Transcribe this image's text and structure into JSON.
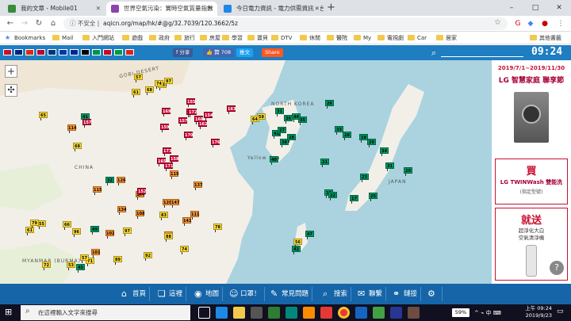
{
  "browser": {
    "tabs": [
      {
        "title": "我的文章 - Mobile01",
        "fav": "#3a8b3a",
        "active": false
      },
      {
        "title": "世界空氣污染：實時空氣質量指數",
        "fav": "#8e44ad",
        "active": true
      },
      {
        "title": "今日電力資訊 - 電力供需資訊 - 台灣電力",
        "fav": "#1e88e5",
        "active": false
      }
    ],
    "new_tab": "+",
    "window_controls": [
      "–",
      "□",
      "✕"
    ],
    "insecure_label": "不安全",
    "url": "aqicn.org/map/hk/#@g/32.7039/120.3662/5z",
    "bookmarks": [
      "Bookmarks",
      "Mail",
      "入門網站",
      "遊戲",
      "政府",
      "旅行",
      "房屋",
      "學習",
      "寶貝",
      "DTV",
      "休閒",
      "醫院",
      "My",
      "電視劇",
      "Car",
      "居家",
      "其他書籤"
    ]
  },
  "site": {
    "flag_colors": [
      "#c8102e",
      "#00247d",
      "#de2910",
      "#bc002d",
      "#003478",
      "#0039a6",
      "#002395",
      "#000000",
      "#009246",
      "#c60b1e",
      "#009c3b",
      "#da251d"
    ],
    "share_buttons": [
      {
        "label": "f 分享",
        "color": "#3b5998"
      },
      {
        "label": "👍 贊 708",
        "color": "#4267b2"
      },
      {
        "label": "推文",
        "color": "#1da1f2"
      },
      {
        "label": "Share",
        "color": "#ff5722"
      }
    ],
    "clock": "09:24"
  },
  "map": {
    "labels": [
      {
        "text": "GOBI DESERT",
        "id": "gobi"
      },
      {
        "text": "CHINA",
        "id": "china"
      },
      {
        "text": "NORTH KOREA",
        "id": "nk"
      },
      {
        "text": "Yellow Sea",
        "id": "ys"
      },
      {
        "text": "MYANMAR (BURMA)",
        "id": "mm"
      },
      {
        "text": "JAPAN",
        "id": "jp"
      }
    ],
    "sample_readings": [
      {
        "region": "gobi",
        "values": [
          53,
          57,
          74,
          61,
          97,
          68
        ]
      },
      {
        "region": "west-china",
        "values": [
          41,
          114,
          157,
          68,
          65,
          32
        ]
      },
      {
        "region": "north-china-plain",
        "values": [
          159,
          163,
          170,
          154,
          171,
          161,
          168,
          173,
          157,
          165,
          158,
          172,
          162,
          176,
          169,
          155
        ]
      },
      {
        "region": "central-china",
        "values": [
          115,
          128,
          137,
          144,
          108,
          152,
          126,
          119,
          134,
          141,
          111,
          147
        ]
      },
      {
        "region": "south-china",
        "values": [
          83,
          97,
          102,
          74,
          89,
          96,
          105,
          71,
          92,
          88,
          101,
          78
        ]
      },
      {
        "region": "southwest",
        "values": [
          61,
          57,
          45,
          72,
          55,
          79,
          53,
          49,
          66
        ]
      },
      {
        "region": "korea",
        "values": [
          38,
          42,
          27,
          35,
          31,
          44,
          36,
          28,
          40
        ]
      },
      {
        "region": "japan",
        "values": [
          23,
          17,
          31,
          28,
          19,
          26,
          33,
          21,
          18,
          25,
          29,
          22,
          34,
          20
        ]
      },
      {
        "region": "taiwan",
        "values": [
          42,
          47,
          56
        ]
      },
      {
        "region": "nk-seoul",
        "values": [
          58,
          64
        ]
      }
    ]
  },
  "ads": {
    "ad1_promo": "2019/7/1~2019/11/30",
    "ad1_brand": "LG 智慧家庭 聯享節",
    "ad2_big": "買",
    "ad2_sub": "LG TWINWash 雙能洗",
    "ad2_sub2": "(指定型號)",
    "ad3_big": "就送",
    "ad3_sub": "超淨化大白\n空氣清淨機",
    "help": "?"
  },
  "bottom_nav": [
    {
      "icon": "⌂",
      "label": "首頁"
    },
    {
      "icon": "❏",
      "label": "這裡"
    },
    {
      "icon": "◉",
      "label": "地圖"
    },
    {
      "icon": "☺",
      "label": "口罩！"
    },
    {
      "icon": "✎",
      "label": "常見問題"
    },
    {
      "icon": "⌕",
      "label": "搜索"
    },
    {
      "icon": "✉",
      "label": "聯繫"
    },
    {
      "icon": "⚭",
      "label": "鏈接"
    },
    {
      "icon": "⚙",
      "label": ""
    }
  ],
  "taskbar": {
    "search_placeholder": "在這裡輸入文字來搜尋",
    "battery": "59%",
    "tray_text": "^  ⌁  中  ⌨",
    "time": "上午 09:24",
    "date": "2019/9/23"
  }
}
